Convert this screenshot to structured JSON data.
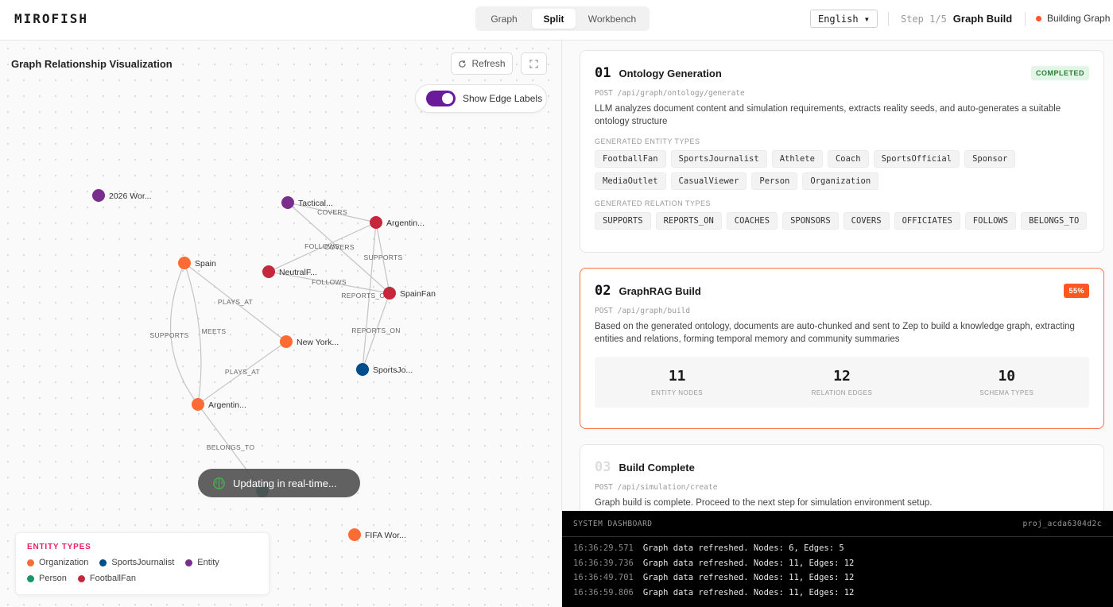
{
  "header": {
    "brand": "MIROFISH",
    "views": [
      "Graph",
      "Split",
      "Workbench"
    ],
    "active_view": "Split",
    "language": "English ▾",
    "step_num": "Step 1/5",
    "step_name": "Graph Build",
    "status": "Building Graph"
  },
  "graph": {
    "title": "Graph Relationship Visualization",
    "refresh_label": "Refresh",
    "edge_labels_toggle": "Show Edge Labels",
    "toast": "Updating in real-time...",
    "nodes": [
      {
        "id": "n2026",
        "label": "2026 Wor...",
        "type": "Entity"
      },
      {
        "id": "ntac",
        "label": "Tactical...",
        "type": "Entity"
      },
      {
        "id": "narg1",
        "label": "Argentin...",
        "type": "FootballFan"
      },
      {
        "id": "nspain",
        "label": "Spain",
        "type": "Organization"
      },
      {
        "id": "nneut",
        "label": "NeutralF...",
        "type": "FootballFan"
      },
      {
        "id": "nspfan",
        "label": "SpainFan",
        "type": "FootballFan"
      },
      {
        "id": "nny",
        "label": "New York...",
        "type": "Organization"
      },
      {
        "id": "nsj",
        "label": "SportsJo...",
        "type": "SportsJournalist"
      },
      {
        "id": "narg2",
        "label": "Argentin...",
        "type": "Organization"
      },
      {
        "id": "nhidden",
        "label": "",
        "type": "Person"
      },
      {
        "id": "nfifa",
        "label": "FIFA Wor...",
        "type": "Organization"
      }
    ],
    "edge_labels": [
      "COVERS",
      "FOLLOWS",
      "COVERS",
      "SUPPORTS",
      "FOLLOWS",
      "REPORTS_ON",
      "REPORTS_ON",
      "PLAYS_AT",
      "MEETS",
      "SUPPORTS",
      "PLAYS_AT",
      "BELONGS_TO"
    ],
    "legend": {
      "title": "ENTITY TYPES",
      "items": [
        {
          "label": "Organization",
          "color": "#ff6b35"
        },
        {
          "label": "SportsJournalist",
          "color": "#004e89"
        },
        {
          "label": "Entity",
          "color": "#7b2d8e"
        },
        {
          "label": "Person",
          "color": "#1a936f"
        },
        {
          "label": "FootballFan",
          "color": "#c5283d"
        }
      ]
    }
  },
  "steps": [
    {
      "num": "01",
      "title": "Ontology Generation",
      "badge": "COMPLETED",
      "endpoint": "POST /api/graph/ontology/generate",
      "desc": "LLM analyzes document content and simulation requirements, extracts reality seeds, and auto-generates a suitable ontology structure",
      "entity_label": "GENERATED ENTITY TYPES",
      "entity_types": [
        "FootballFan",
        "SportsJournalist",
        "Athlete",
        "Coach",
        "SportsOfficial",
        "Sponsor",
        "MediaOutlet",
        "CasualViewer",
        "Person",
        "Organization"
      ],
      "relation_label": "GENERATED RELATION TYPES",
      "relation_types": [
        "SUPPORTS",
        "REPORTS_ON",
        "COACHES",
        "SPONSORS",
        "COVERS",
        "OFFICIATES",
        "FOLLOWS",
        "BELONGS_TO"
      ]
    },
    {
      "num": "02",
      "title": "GraphRAG Build",
      "badge": "55%",
      "endpoint": "POST /api/graph/build",
      "desc": "Based on the generated ontology, documents are auto-chunked and sent to Zep to build a knowledge graph, extracting entities and relations, forming temporal memory and community summaries",
      "stats": [
        {
          "value": "11",
          "label": "ENTITY NODES"
        },
        {
          "value": "12",
          "label": "RELATION EDGES"
        },
        {
          "value": "10",
          "label": "SCHEMA TYPES"
        }
      ]
    },
    {
      "num": "03",
      "title": "Build Complete",
      "endpoint": "POST /api/simulation/create",
      "desc": "Graph build is complete. Proceed to the next step for simulation environment setup."
    }
  ],
  "console": {
    "title": "SYSTEM DASHBOARD",
    "project": "proj_acda6304d2c",
    "logs": [
      {
        "time": "16:36:29.571",
        "msg": "Graph data refreshed. Nodes: 6, Edges: 5"
      },
      {
        "time": "16:36:39.736",
        "msg": "Graph data refreshed. Nodes: 11, Edges: 12"
      },
      {
        "time": "16:36:49.701",
        "msg": "Graph data refreshed. Nodes: 11, Edges: 12"
      },
      {
        "time": "16:36:59.806",
        "msg": "Graph data refreshed. Nodes: 11, Edges: 12"
      }
    ]
  }
}
